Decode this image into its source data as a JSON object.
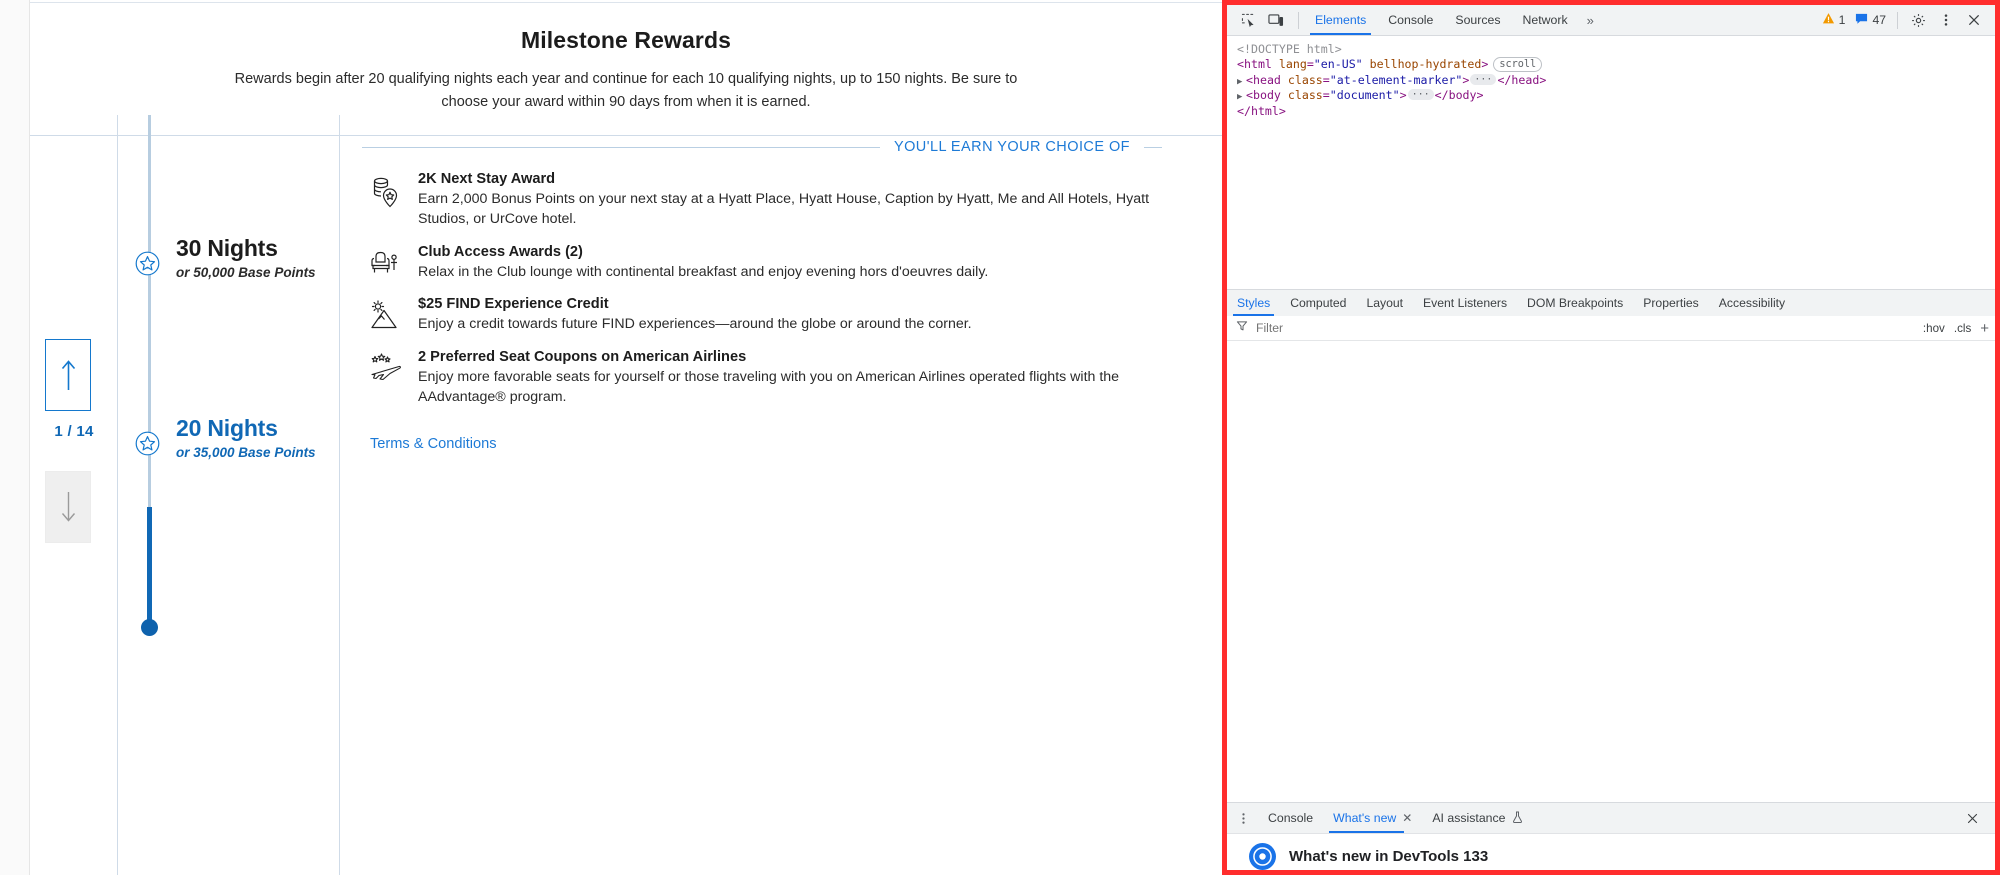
{
  "page": {
    "title": "Milestone Rewards",
    "subtitle": "Rewards begin after 20 qualifying nights each year and continue for each 10 qualifying nights, up to 150 nights. Be sure to choose your award within 90 days from when it is earned.",
    "nav": {
      "up_label": "up-arrow",
      "down_label": "down-arrow",
      "counter": "1 / 14"
    },
    "timeline": [
      {
        "nights": "30 Nights",
        "points": "or 50,000 Base Points",
        "state": "inactive"
      },
      {
        "nights": "20 Nights",
        "points": "or 35,000 Base Points",
        "state": "active"
      }
    ],
    "choice_header": "YOU'LL EARN YOUR CHOICE OF",
    "rewards": [
      {
        "icon": "coins-pin-icon",
        "title": "2K Next Stay Award",
        "desc": "Earn 2,000 Bonus Points on your next stay at a Hyatt Place, Hyatt House, Caption by Hyatt, Me and All Hotels, Hyatt Studios, or UrCove hotel."
      },
      {
        "icon": "lounge-chair-icon",
        "title": "Club Access Awards (2)",
        "desc": "Relax in the Club lounge with continental breakfast and enjoy evening hors d'oeuvres daily."
      },
      {
        "icon": "mountain-sun-icon",
        "title": "$25 FIND Experience Credit",
        "desc": "Enjoy a credit towards future FIND experiences—around the globe or around the corner."
      },
      {
        "icon": "airplane-stars-icon",
        "title": "2 Preferred Seat Coupons on American Airlines",
        "desc": "Enjoy more favorable seats for yourself or those traveling with you on American Airlines operated flights with the AAdvantage® program."
      }
    ],
    "terms_link": "Terms & Conditions"
  },
  "devtools": {
    "accent_color": "#1a73e8",
    "highlight_border_color": "#ff2d2d",
    "toolbar": {
      "inspect_icon": "inspect-element-icon",
      "device_icon": "device-toolbar-icon",
      "tabs": [
        {
          "label": "Elements",
          "active": true
        },
        {
          "label": "Console",
          "active": false
        },
        {
          "label": "Sources",
          "active": false
        },
        {
          "label": "Network",
          "active": false
        }
      ],
      "more_tabs": "»",
      "warning_count": "1",
      "message_count": "47",
      "settings_icon": "gear-icon",
      "menu_icon": "kebab-menu-icon",
      "close_icon": "close-icon"
    },
    "dom": {
      "line1": "<!DOCTYPE html>",
      "line2_tag_open": "<html",
      "line2_attr1": "lang",
      "line2_val1": "\"en-US\"",
      "line2_attr2": "bellhop-hydrated",
      "line2_tag_close": ">",
      "line2_badge": "scroll",
      "line3_tag_open": "<head",
      "line3_attr": "class",
      "line3_val": "\"at-element-marker\"",
      "line3_gt": ">",
      "line3_close": "</head>",
      "line4_tag_open": "<body",
      "line4_attr": "class",
      "line4_val": "\"document\"",
      "line4_gt": ">",
      "line4_close": "</body>",
      "line5": "</html>"
    },
    "styles": {
      "tabs": [
        {
          "label": "Styles",
          "active": true
        },
        {
          "label": "Computed",
          "active": false
        },
        {
          "label": "Layout",
          "active": false
        },
        {
          "label": "Event Listeners",
          "active": false
        },
        {
          "label": "DOM Breakpoints",
          "active": false
        },
        {
          "label": "Properties",
          "active": false
        },
        {
          "label": "Accessibility",
          "active": false
        }
      ],
      "filter_placeholder": "Filter",
      "filter_value": "",
      "hov_label": ":hov",
      "cls_label": ".cls",
      "add_label": "+"
    },
    "drawer": {
      "menu_icon": "kebab-menu-icon",
      "tabs": [
        {
          "label": "Console",
          "active": false,
          "closable": false,
          "beta": false
        },
        {
          "label": "What's new",
          "active": true,
          "closable": true,
          "beta": false
        },
        {
          "label": "AI assistance",
          "active": false,
          "closable": false,
          "beta": true
        }
      ],
      "close_icon": "close-icon",
      "content_title": "What's new in DevTools 133"
    }
  }
}
